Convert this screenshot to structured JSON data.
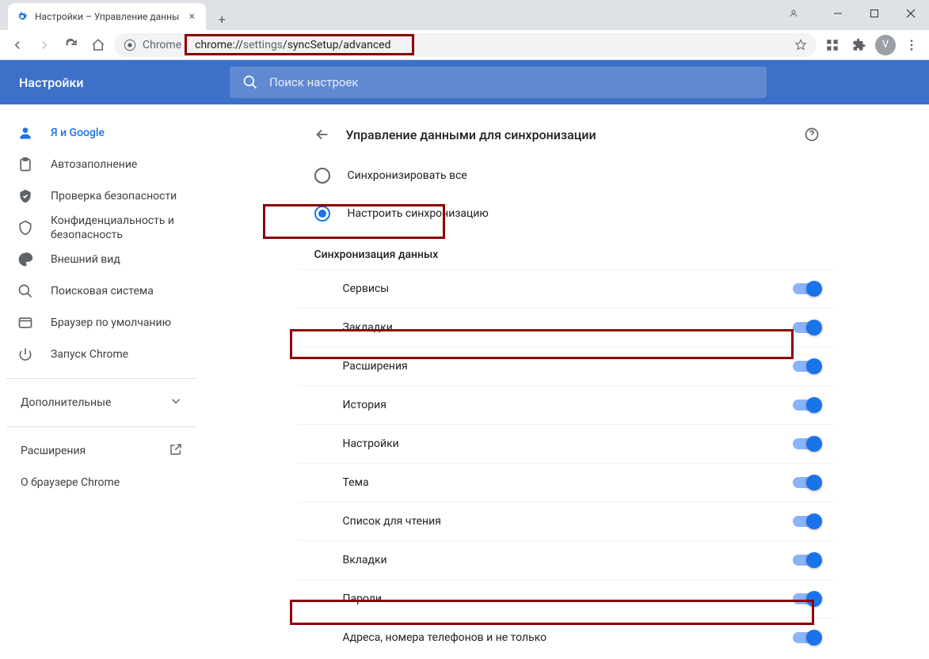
{
  "tab": {
    "title": "Настройки – Управление данны"
  },
  "omnibox": {
    "prefix": "Chrome",
    "url_plain": "chrome://",
    "url_dark": "settings",
    "url_rest": "/syncSetup/advanced"
  },
  "avatar_letter": "V",
  "app_title": "Настройки",
  "search_placeholder": "Поиск настроек",
  "sidebar": {
    "items": [
      {
        "label": "Я и Google",
        "icon": "person"
      },
      {
        "label": "Автозаполнение",
        "icon": "clipboard"
      },
      {
        "label": "Проверка безопасности",
        "icon": "shield-check"
      },
      {
        "label": "Конфиденциальность и безопасность",
        "icon": "shield"
      },
      {
        "label": "Внешний вид",
        "icon": "palette"
      },
      {
        "label": "Поисковая система",
        "icon": "search"
      },
      {
        "label": "Браузер по умолчанию",
        "icon": "browser"
      },
      {
        "label": "Запуск Chrome",
        "icon": "power"
      }
    ],
    "advanced": "Дополнительные",
    "extensions": "Расширения",
    "about": "О браузере Chrome"
  },
  "page": {
    "title": "Управление данными для синхронизации",
    "radio_all": "Синхронизировать все",
    "radio_custom": "Настроить синхронизацию",
    "section": "Синхронизация данных",
    "toggles": [
      {
        "label": "Сервисы",
        "on": true
      },
      {
        "label": "Закладки",
        "on": true
      },
      {
        "label": "Расширения",
        "on": true
      },
      {
        "label": "История",
        "on": true
      },
      {
        "label": "Настройки",
        "on": true
      },
      {
        "label": "Тема",
        "on": true
      },
      {
        "label": "Список для чтения",
        "on": true
      },
      {
        "label": "Вкладки",
        "on": true
      },
      {
        "label": "Пароли",
        "on": true
      },
      {
        "label": "Адреса, номера телефонов и не только",
        "on": true
      }
    ]
  }
}
